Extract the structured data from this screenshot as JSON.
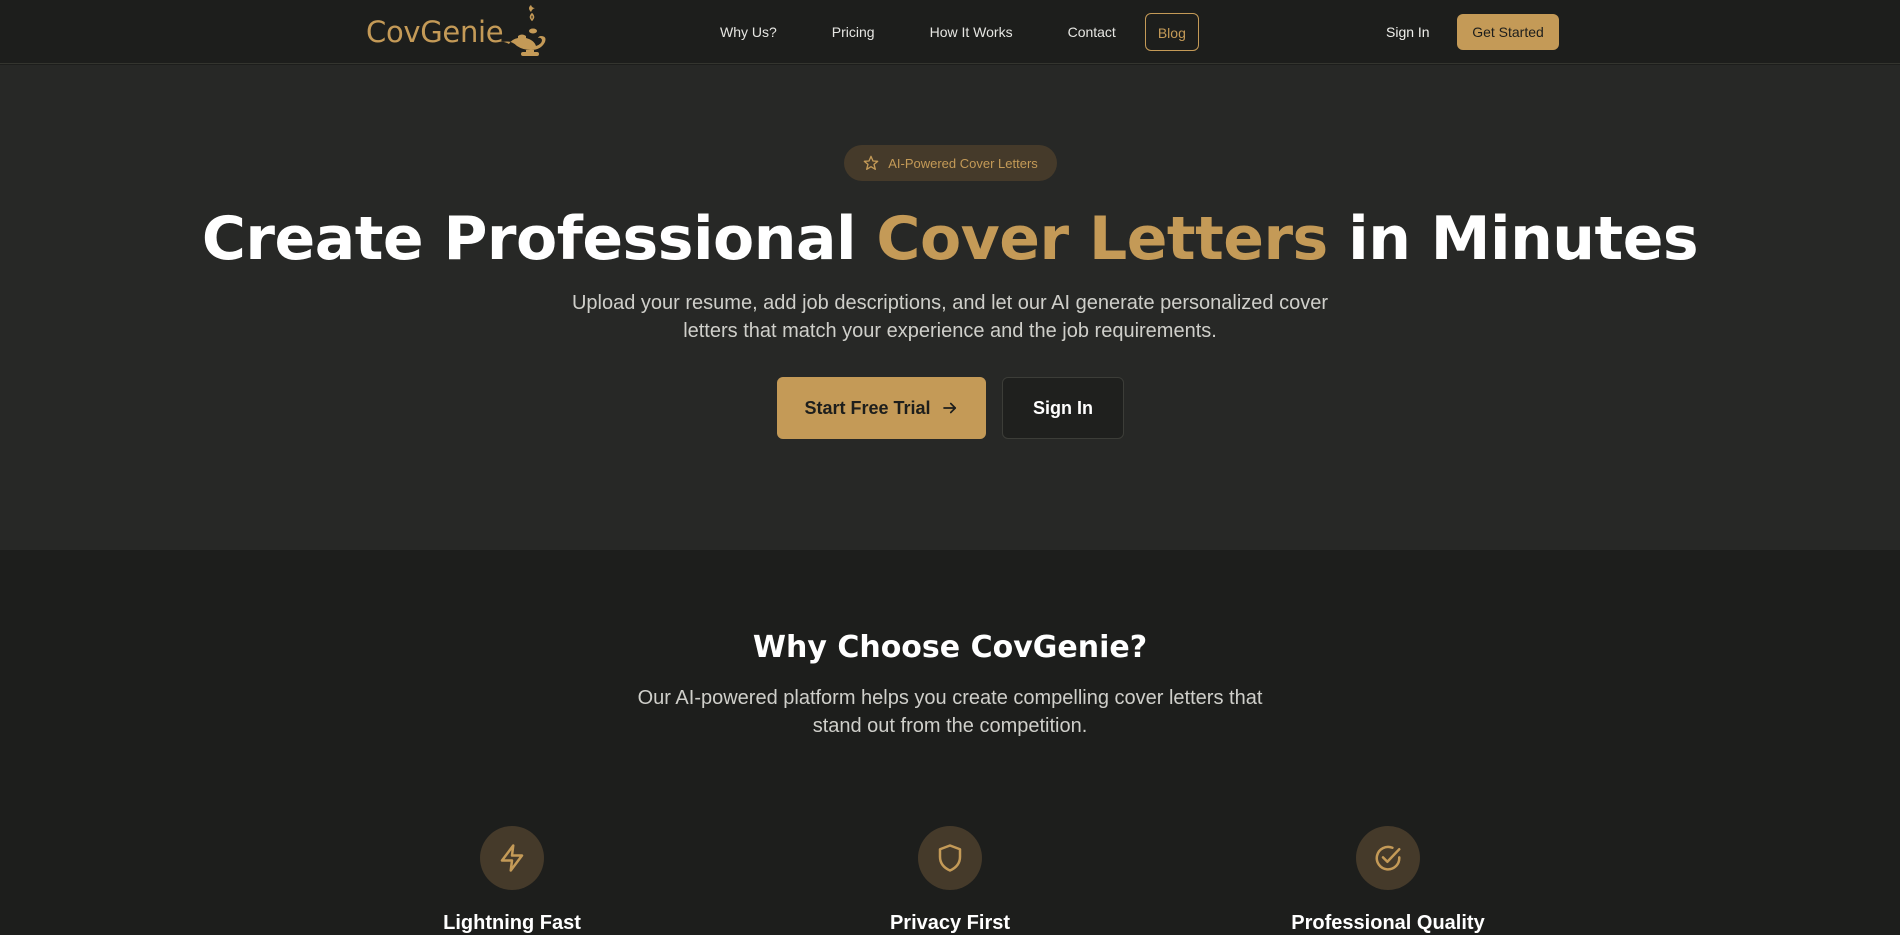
{
  "brand": {
    "name": "CovGenie",
    "accent_color": "#c49a57",
    "logo_icon": "genie-lamp-icon"
  },
  "nav": {
    "links": [
      "Why Us?",
      "Pricing",
      "How It Works",
      "Contact",
      "Blog"
    ],
    "sign_in": "Sign In",
    "get_started": "Get Started"
  },
  "hero": {
    "badge_icon": "star-icon",
    "badge": "AI-Powered Cover Letters",
    "title_before": "Create Professional ",
    "title_accent": "Cover Letters",
    "title_after": " in Minutes",
    "subtitle": "Upload your resume, add job descriptions, and let our AI generate personalized cover letters that match your experience and the job requirements.",
    "primary_button": "Start Free Trial",
    "primary_button_icon": "arrow-right-icon",
    "secondary_button": "Sign In"
  },
  "why": {
    "title": "Why Choose CovGenie?",
    "subtitle": "Our AI-powered platform helps you create compelling cover letters that stand out from the competition.",
    "features": [
      {
        "icon": "lightning-icon",
        "title": "Lightning Fast"
      },
      {
        "icon": "shield-icon",
        "title": "Privacy First"
      },
      {
        "icon": "check-circle-icon",
        "title": "Professional Quality"
      }
    ]
  },
  "colors": {
    "background": "#1d1e1c",
    "hero_background": "#272826",
    "accent": "#c49a57",
    "badge_background": "#453a2a"
  }
}
